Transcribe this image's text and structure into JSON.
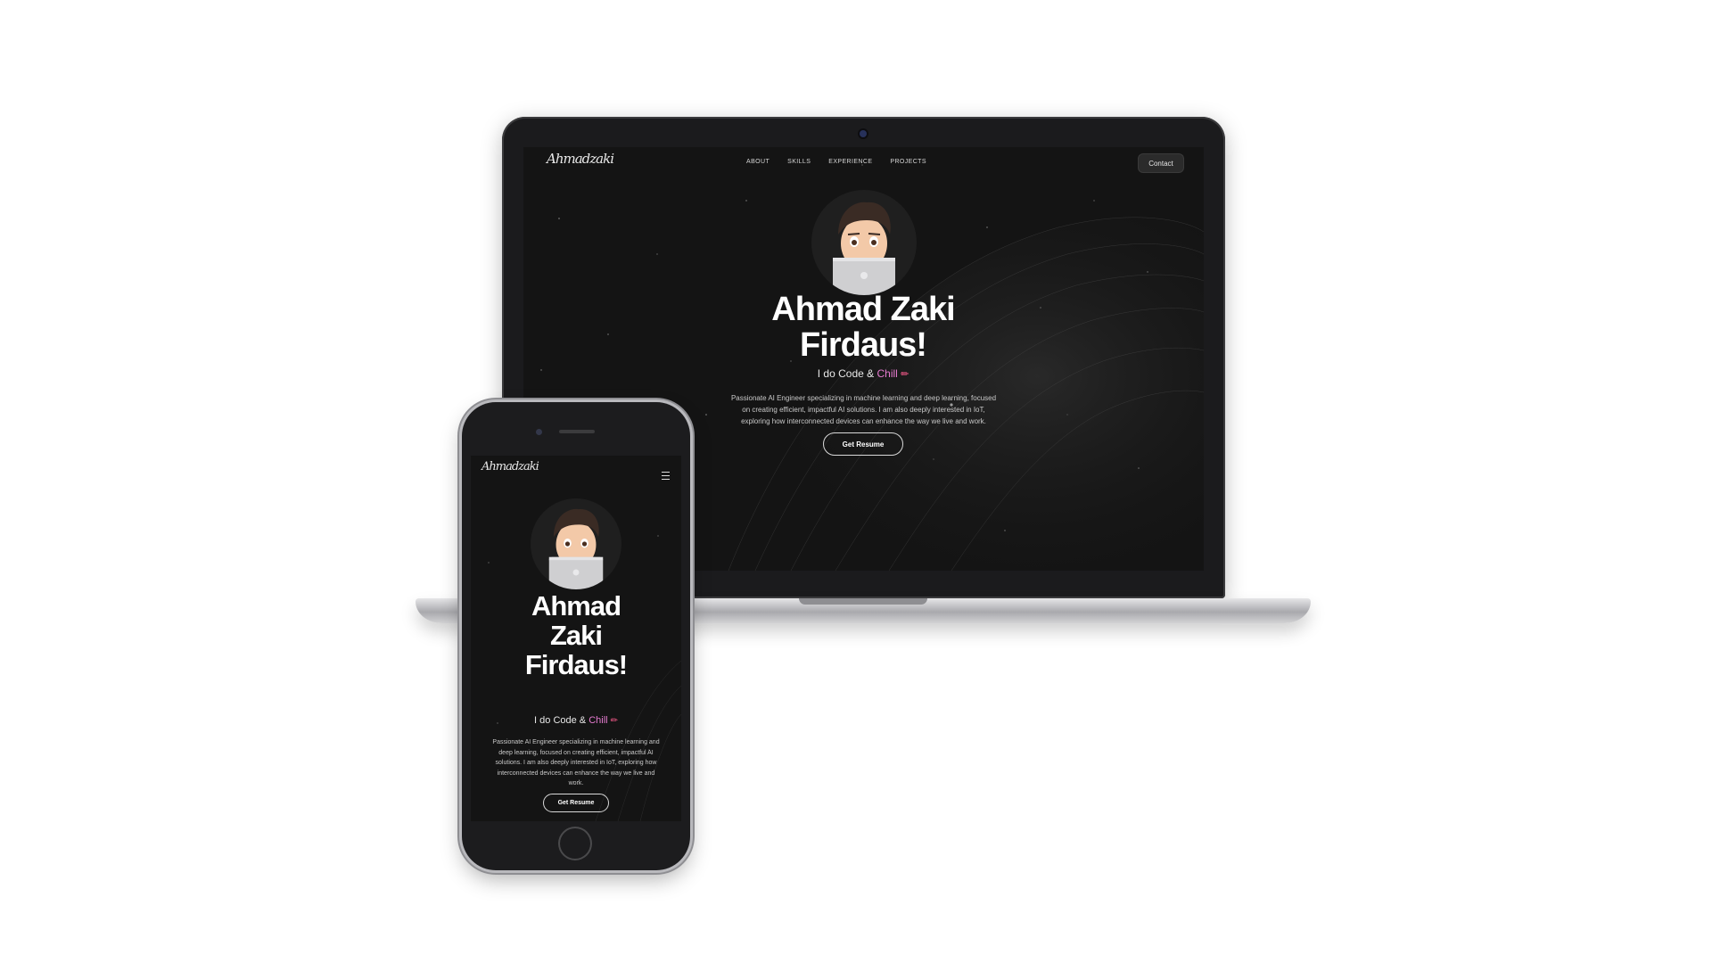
{
  "site": {
    "logo_text": "Ahmadzaki",
    "nav": [
      {
        "label": "ABOUT"
      },
      {
        "label": "SKILLS"
      },
      {
        "label": "EXPERIENCE"
      },
      {
        "label": "PROJECTS"
      }
    ],
    "contact_label": "Contact",
    "hero": {
      "name_line1": "Ahmad Zaki",
      "name_line2": "Firdaus!",
      "mobile_line1": "Ahmad",
      "mobile_line2": "Zaki",
      "mobile_line3": "Firdaus!",
      "tagline_prefix": "I do Code & ",
      "tagline_highlight": "Chill",
      "tagline_emoji": "✏",
      "description": "Passionate AI Engineer specializing in machine learning and deep learning, focused on creating efficient, impactful AI solutions. I am also deeply interested in IoT, exploring how interconnected devices can enhance the way we live and work.",
      "resume_label": "Get Resume"
    }
  },
  "colors": {
    "background": "#141414",
    "accent_chill": "#e57bd0",
    "accent_pencil": "#ff5d8f"
  },
  "icons": {
    "avatar": "memoji-avatar-with-laptop",
    "menu": "hamburger-menu-icon"
  }
}
